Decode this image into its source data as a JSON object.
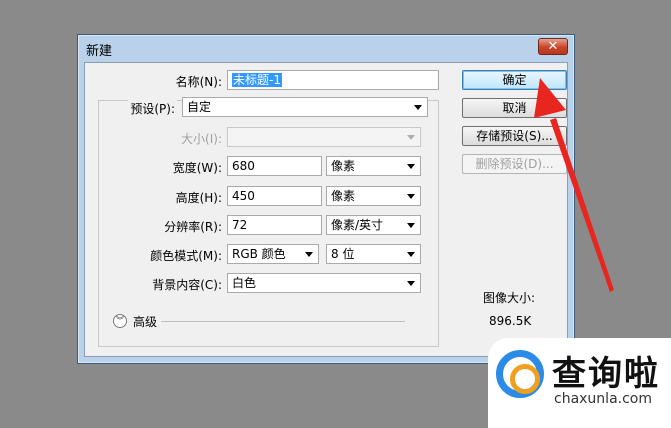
{
  "dialog": {
    "title": "新建",
    "close_label": "✕"
  },
  "form": {
    "name_label": "名称(N):",
    "name_value": "未标题-1",
    "preset_label": "预设(P):",
    "preset_value": "自定",
    "size_label": "大小(I):",
    "size_value": "",
    "width_label": "宽度(W):",
    "width_value": "680",
    "width_unit": "像素",
    "height_label": "高度(H):",
    "height_value": "450",
    "height_unit": "像素",
    "resolution_label": "分辨率(R):",
    "resolution_value": "72",
    "resolution_unit": "像素/英寸",
    "color_mode_label": "颜色模式(M):",
    "color_mode_value": "RGB 颜色",
    "bit_depth_value": "8 位",
    "background_label": "背景内容(C):",
    "background_value": "白色",
    "advanced_label": "高级"
  },
  "buttons": {
    "ok": "确定",
    "cancel": "取消",
    "save_preset": "存储预设(S)...",
    "delete_preset": "删除预设(D)..."
  },
  "image_size": {
    "label": "图像大小:",
    "value": "896.5K"
  },
  "watermark": {
    "text": "查询啦",
    "url": "chaxunla.com"
  },
  "colors": {
    "annotation_arrow": "#e8261f",
    "title_bar": "#b9d1ea",
    "selection": "#3399ff"
  }
}
